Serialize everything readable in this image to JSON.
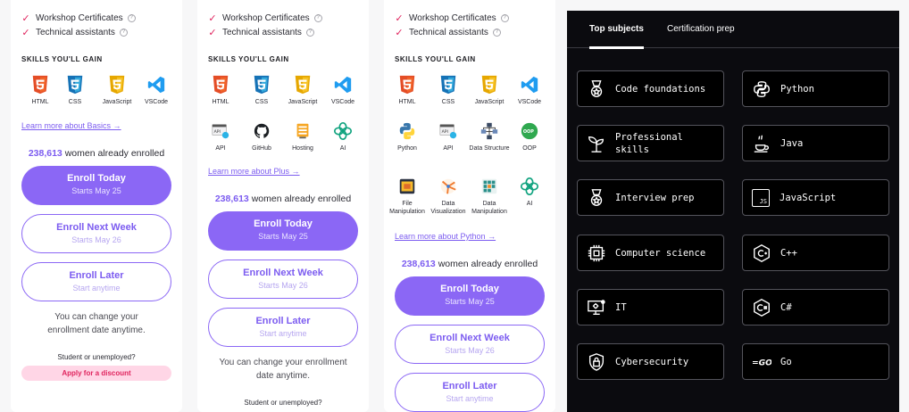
{
  "features": {
    "workshop": "Workshop Certificates",
    "assistants": "Technical assistants"
  },
  "skills_heading": "SKILLS YOU'LL GAIN",
  "card1": {
    "skills": [
      "HTML",
      "CSS",
      "JavaScript",
      "VSCode"
    ],
    "learn_more": "Learn more about Basics →",
    "enrolled_count": "238,613",
    "enrolled_text": "women already enrolled"
  },
  "card2": {
    "skills": [
      "HTML",
      "CSS",
      "JavaScript",
      "VSCode",
      "API",
      "GitHub",
      "Hosting",
      "AI"
    ],
    "learn_more": "Learn more about Plus →",
    "enrolled_count": "238,613",
    "enrolled_text": "women already enrolled"
  },
  "card3": {
    "skills": [
      "HTML",
      "CSS",
      "JavaScript",
      "VSCode",
      "Python",
      "API",
      "Data Structure",
      "OOP",
      "File Manipulation",
      "Data Visualization",
      "Data Manipulation",
      "AI"
    ],
    "learn_more": "Learn more about Python →",
    "enrolled_count": "238,613",
    "enrolled_text": "women already enrolled"
  },
  "enroll": {
    "today": "Enroll Today",
    "today_sub": "Starts May 25",
    "next_week": "Enroll Next Week",
    "next_week_sub": "Starts May 26",
    "later": "Enroll Later",
    "later_sub": "Start anytime"
  },
  "change_note": "You can change your enrollment date anytime.",
  "student": "Student or unemployed?",
  "discount": "Apply for a discount",
  "colors": {
    "accent": "#8b67f5",
    "check": "#e0245e",
    "dark_bg": "#0b0b0f"
  },
  "subjects": {
    "tabs": [
      "Top subjects",
      "Certification prep"
    ],
    "active_tab": "Top subjects",
    "tiles": [
      {
        "label": "Code foundations",
        "icon": "medal-icon"
      },
      {
        "label": "Python",
        "icon": "python-icon"
      },
      {
        "label": "Professional skills",
        "icon": "sprout-icon"
      },
      {
        "label": "Java",
        "icon": "coffee-cup-icon"
      },
      {
        "label": "Interview prep",
        "icon": "medal-icon"
      },
      {
        "label": "JavaScript",
        "icon": "js-icon"
      },
      {
        "label": "Computer science",
        "icon": "chip-icon"
      },
      {
        "label": "C++",
        "icon": "cpp-icon"
      },
      {
        "label": "IT",
        "icon": "monitor-gear-icon"
      },
      {
        "label": "C#",
        "icon": "csharp-icon"
      },
      {
        "label": "Cybersecurity",
        "icon": "lock-shield-icon"
      },
      {
        "label": "Go",
        "icon": "go-icon"
      }
    ]
  }
}
